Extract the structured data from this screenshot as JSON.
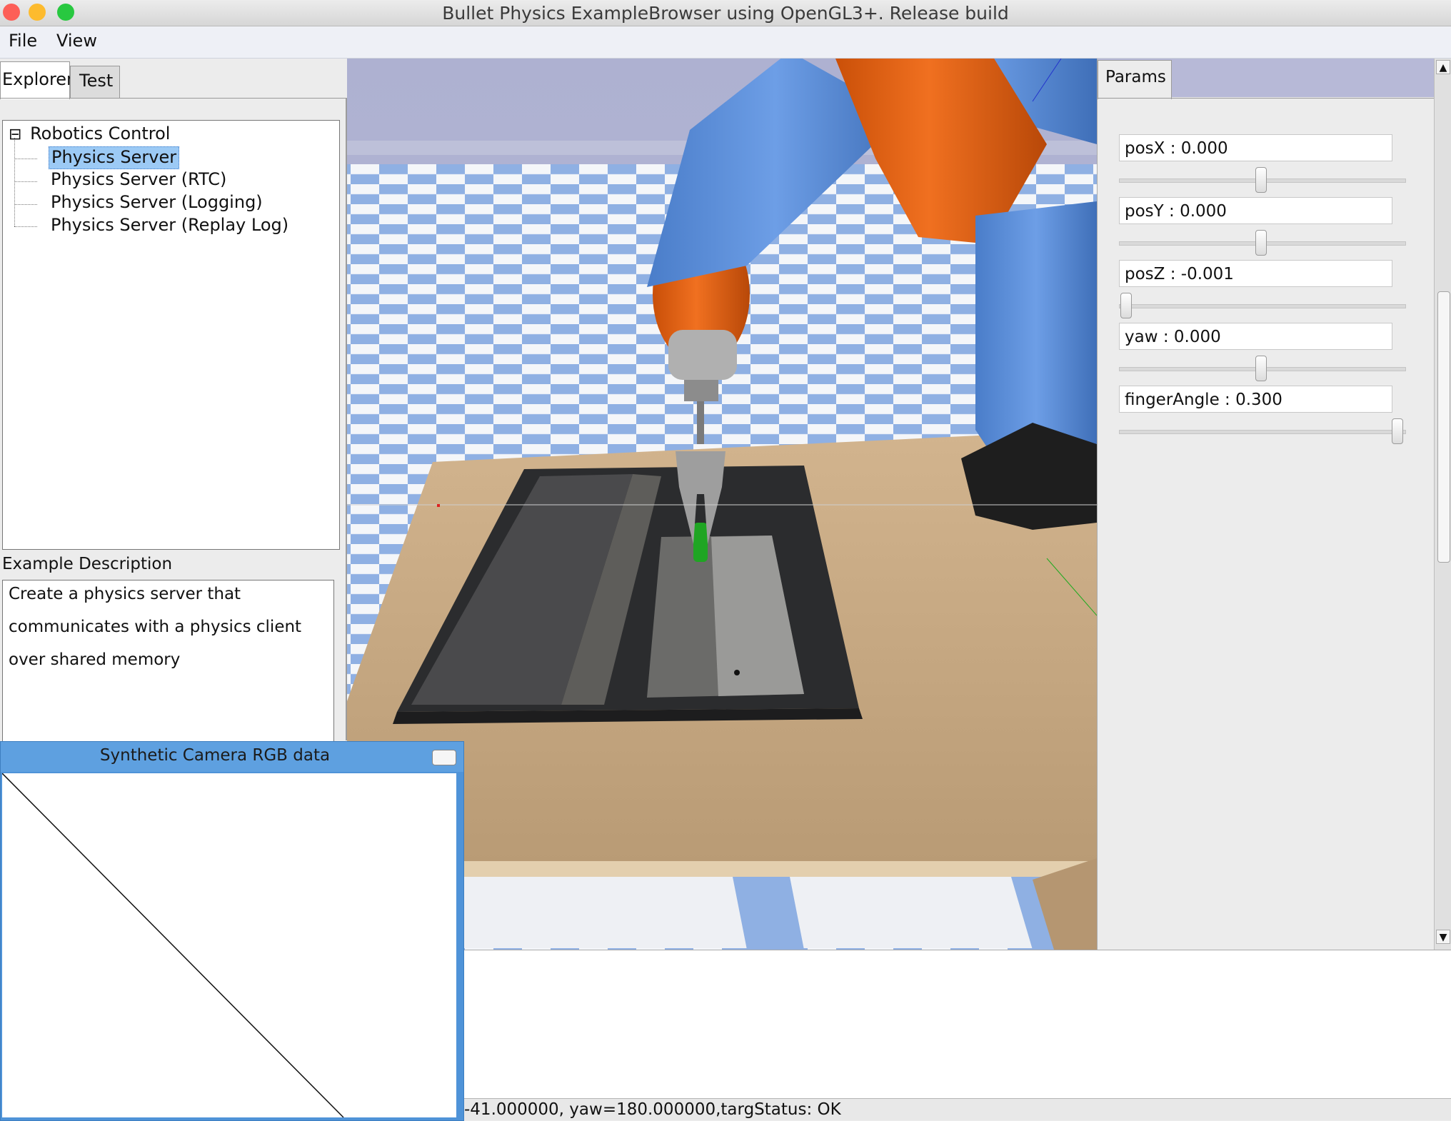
{
  "window": {
    "title": "Bullet Physics ExampleBrowser using OpenGL3+. Release build",
    "traffic_lights": {
      "close": "#fd5f57",
      "minimize": "#fdbb2e",
      "zoom": "#28c840"
    }
  },
  "menubar": {
    "items": [
      "File",
      "View"
    ]
  },
  "left_panel": {
    "tabs": [
      "Explorer",
      "Test"
    ],
    "tree": {
      "root": "Robotics Control",
      "collapse_glyph": "⊟",
      "items": [
        "Physics Server",
        "Physics Server (RTC)",
        "Physics Server (Logging)",
        "Physics Server (Replay Log)"
      ],
      "selected_index": 0
    },
    "description": {
      "heading": "Example Description",
      "lines": [
        "Create a physics server that",
        "communicates with a physics client",
        "over shared memory"
      ]
    }
  },
  "params": {
    "tab": "Params",
    "sliders": [
      {
        "label": "posX : 0.000",
        "value": 0.5
      },
      {
        "label": "posY : 0.000",
        "value": 0.5
      },
      {
        "label": "posZ : -0.001",
        "value": 0.0
      },
      {
        "label": "yaw : 0.000",
        "value": 0.5
      },
      {
        "label": "fingerAngle : 0.300",
        "value": 1.0
      }
    ]
  },
  "camera_window": {
    "title": "Synthetic Camera RGB data"
  },
  "statusbar": {
    "text": "-41.000000, yaw=180.000000,targStatus: OK"
  },
  "colors": {
    "accent": "#5ea0e0",
    "selection": "#9ccaf5",
    "robot_blue": "#5b8ed9",
    "robot_orange": "#e8620f",
    "floor_blue": "#8fb0e3",
    "table": "#c7a880"
  }
}
